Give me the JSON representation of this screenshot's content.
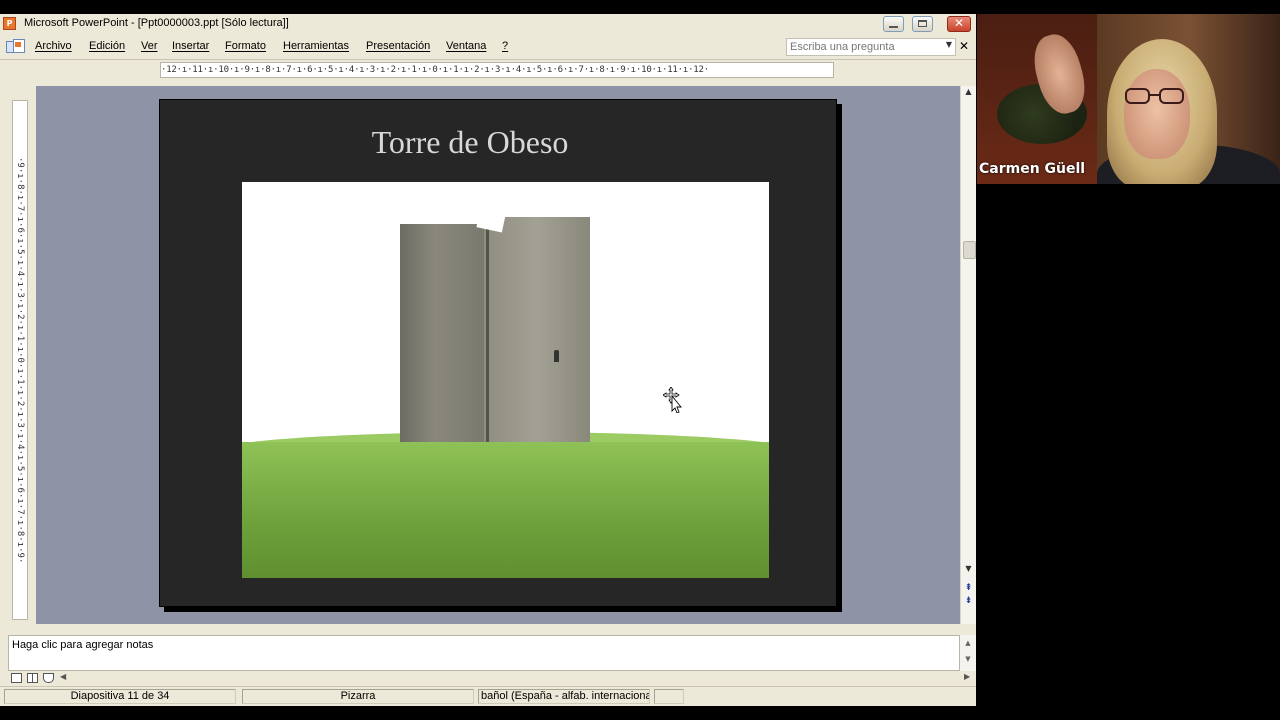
{
  "window": {
    "title": "Microsoft PowerPoint - [Ppt0000003.ppt [Sólo lectura]]",
    "app_icon_letter": "P"
  },
  "menu": {
    "items": [
      "Archivo",
      "Edición",
      "Ver",
      "Insertar",
      "Formato",
      "Herramientas",
      "Presentación",
      "Ventana",
      "?"
    ],
    "ask_placeholder": "Escriba una pregunta"
  },
  "rulers": {
    "horizontal": "·12·ı·11·ı·10·ı·9·ı·8·ı·7·ı·6·ı·5·ı·4·ı·3·ı·2·ı·1·ı·0·ı·1·ı·2·ı·3·ı·4·ı·5·ı·6·ı·7·ı·8·ı·9·ı·10·ı·11·ı·12·",
    "vertical": "·9·ı·8·ı·7·ı·6·ı·5·ı·4·ı·3·ı·2·ı·1·ı·0·ı·1·ı·2·ı·3·ı·4·ı·5·ı·6·ı·7·ı·8·ı·9·"
  },
  "slide": {
    "title": "Torre de Obeso",
    "image_alt": "tower-on-grassy-hill-photo"
  },
  "notes": {
    "placeholder": "Haga clic para agregar notas"
  },
  "status": {
    "slide_counter": "Diapositiva 11 de 34",
    "design": "Pizarra",
    "language": "bañol (España - alfab. internacional)"
  },
  "video": {
    "participant_name": "Carmen Güell"
  },
  "colors": {
    "xp_face": "#ece9d8",
    "slide_background": "#262626",
    "slide_title": "#d8d8d8",
    "workspace": "#8e94a6",
    "close_button": "#c9432a"
  }
}
